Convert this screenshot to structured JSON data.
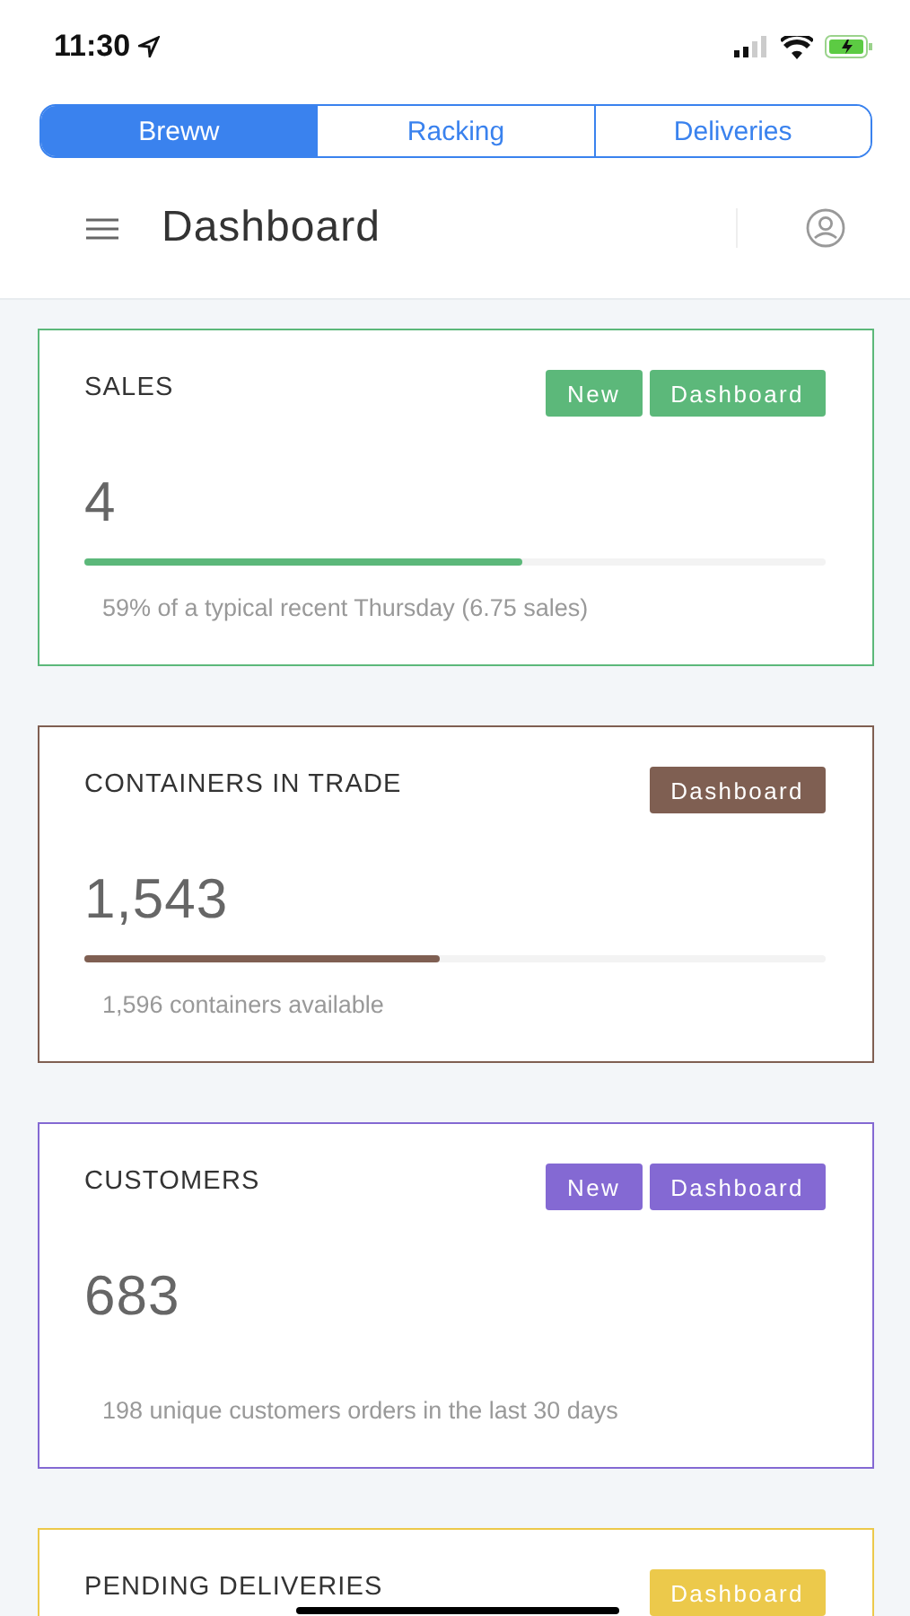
{
  "status_bar": {
    "time": "11:30"
  },
  "tabs": [
    {
      "label": "Breww",
      "selected": true
    },
    {
      "label": "Racking",
      "selected": false
    },
    {
      "label": "Deliveries",
      "selected": false
    }
  ],
  "header": {
    "title": "Dashboard"
  },
  "cards": [
    {
      "title": "SALES",
      "color": "#5cb87a",
      "buttons": [
        "New",
        "Dashboard"
      ],
      "value": "4",
      "level": 0.59,
      "note": "59% of a typical recent Thursday (6.75 sales)"
    },
    {
      "title": "CONTAINERS IN TRADE",
      "color": "#7f5f52",
      "buttons": [
        "Dashboard"
      ],
      "value": "1,543",
      "level": 0.48,
      "note": "1,596 containers available"
    },
    {
      "title": "CUSTOMERS",
      "color": "#8469d3",
      "buttons": [
        "New",
        "Dashboard"
      ],
      "value": "683",
      "note": "198 unique customers orders in the last 30 days"
    },
    {
      "title": "PENDING DELIVERIES",
      "color": "#ecc94b",
      "buttons": [
        "Dashboard"
      ]
    }
  ]
}
